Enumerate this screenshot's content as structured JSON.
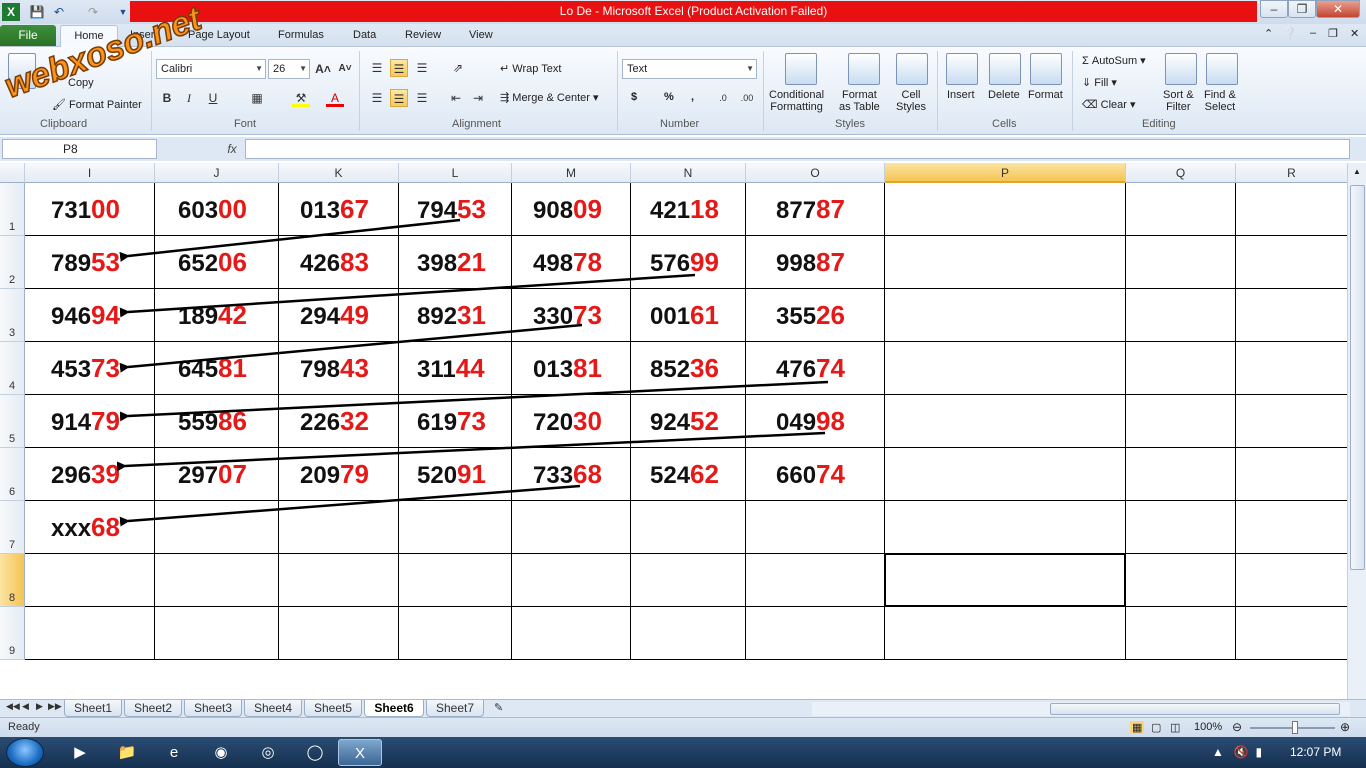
{
  "window": {
    "title": "Lo De  -  Microsoft Excel (Product Activation Failed)"
  },
  "watermark": "webxoso.net",
  "ribbon": {
    "tabs": [
      "File",
      "Home",
      "Insert",
      "Page Layout",
      "Formulas",
      "Data",
      "Review",
      "View"
    ],
    "clipboard": {
      "label": "Clipboard",
      "copy": "Copy",
      "format_painter": "Format Painter"
    },
    "font": {
      "label": "Font",
      "family": "Calibri",
      "size": "26"
    },
    "alignment": {
      "label": "Alignment",
      "wrap": "Wrap Text",
      "merge": "Merge & Center"
    },
    "number": {
      "label": "Number",
      "format": "Text",
      "currency": "$",
      "percent": "%",
      "comma": ","
    },
    "styles": {
      "label": "Styles",
      "conditional": "Conditional\nFormatting",
      "format_table": "Format\nas Table",
      "cell_styles": "Cell\nStyles"
    },
    "cells": {
      "label": "Cells",
      "insert": "Insert",
      "delete": "Delete",
      "format": "Format"
    },
    "editing": {
      "label": "Editing",
      "autosum": "AutoSum",
      "fill": "Fill",
      "clear": "Clear",
      "sort": "Sort &\nFilter",
      "find": "Find &\nSelect"
    }
  },
  "formula_bar": {
    "name_box": "P8",
    "fx": "fx",
    "value": ""
  },
  "columns": [
    "I",
    "J",
    "K",
    "L",
    "M",
    "N",
    "O",
    "P",
    "Q",
    "R"
  ],
  "rows": [
    "1",
    "2",
    "3",
    "4",
    "5",
    "6",
    "7",
    "8",
    "9"
  ],
  "active": {
    "column": "P",
    "row": "8"
  },
  "cells": [
    [
      [
        "731",
        "00"
      ],
      [
        "603",
        "00"
      ],
      [
        "013",
        "67"
      ],
      [
        "794",
        "53"
      ],
      [
        "908",
        "09"
      ],
      [
        "421",
        "18"
      ],
      [
        "877",
        "87"
      ]
    ],
    [
      [
        "789",
        "53"
      ],
      [
        "652",
        "06"
      ],
      [
        "426",
        "83"
      ],
      [
        "398",
        "21"
      ],
      [
        "498",
        "78"
      ],
      [
        "576",
        "99"
      ],
      [
        "998",
        "87"
      ]
    ],
    [
      [
        "946",
        "94"
      ],
      [
        "189",
        "42"
      ],
      [
        "294",
        "49"
      ],
      [
        "892",
        "31"
      ],
      [
        "330",
        "73"
      ],
      [
        "001",
        "61"
      ],
      [
        "355",
        "26"
      ]
    ],
    [
      [
        "453",
        "73"
      ],
      [
        "645",
        "81"
      ],
      [
        "798",
        "43"
      ],
      [
        "311",
        "44"
      ],
      [
        "013",
        "81"
      ],
      [
        "852",
        "36"
      ],
      [
        "476",
        "74"
      ]
    ],
    [
      [
        "914",
        "79"
      ],
      [
        "559",
        "86"
      ],
      [
        "226",
        "32"
      ],
      [
        "619",
        "73"
      ],
      [
        "720",
        "30"
      ],
      [
        "924",
        "52"
      ],
      [
        "049",
        "98"
      ]
    ],
    [
      [
        "296",
        "39"
      ],
      [
        "297",
        "07"
      ],
      [
        "209",
        "79"
      ],
      [
        "520",
        "91"
      ],
      [
        "733",
        "68"
      ],
      [
        "524",
        "62"
      ],
      [
        "660",
        "74"
      ]
    ],
    [
      [
        "xxx",
        "68"
      ]
    ]
  ],
  "sheets": [
    "Sheet1",
    "Sheet2",
    "Sheet3",
    "Sheet4",
    "Sheet5",
    "Sheet6",
    "Sheet7"
  ],
  "active_sheet": "Sheet6",
  "status": {
    "text": "Ready",
    "zoom": "100%"
  },
  "taskbar": {
    "time": "12:07 PM"
  }
}
